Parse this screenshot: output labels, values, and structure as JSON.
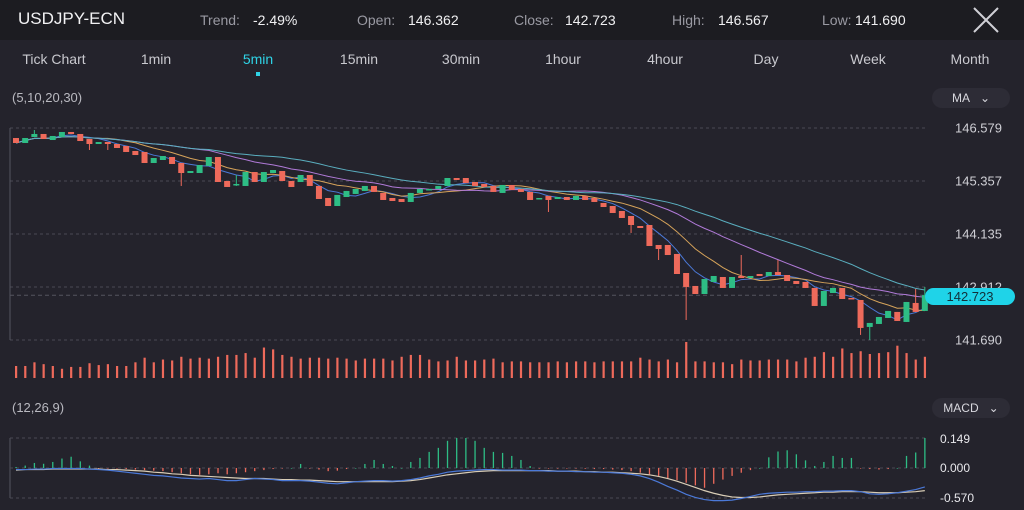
{
  "header": {
    "symbol": "USDJPY-ECN",
    "trend_label": "Trend:",
    "trend": "-2.49%",
    "open_label": "Open:",
    "open": "146.362",
    "close_label": "Close:",
    "close": "142.723",
    "high_label": "High:",
    "high": "146.567",
    "low_label": "Low:",
    "low": "141.690",
    "close_icon": "close-x-icon"
  },
  "tabs": [
    {
      "label": "Tick Chart"
    },
    {
      "label": "1min"
    },
    {
      "label": "5min",
      "active": true
    },
    {
      "label": "15min"
    },
    {
      "label": "30min"
    },
    {
      "label": "1hour"
    },
    {
      "label": "4hour"
    },
    {
      "label": "Day"
    },
    {
      "label": "Week"
    },
    {
      "label": "Month"
    }
  ],
  "indicators": {
    "ma_params": "(5,10,20,30)",
    "ma_select": "MA",
    "macd_params": "(12,26,9)",
    "macd_select": "MACD",
    "chevron_icon": "chevron-down-icon"
  },
  "colors": {
    "up": "#2ebd85",
    "down": "#ee6a5b",
    "accent": "#1fd3e8",
    "ma5": "#4b79d8",
    "ma10": "#d6a35a",
    "ma20": "#b07ad8",
    "ma30": "#5aaebf",
    "macd": "#4b79d8",
    "signal": "#d9cdb6"
  },
  "chart_data": [
    {
      "type": "candlestick",
      "y_ticks": [
        "146.579",
        "145.357",
        "144.135",
        "142.912",
        "141.690"
      ],
      "ylim": [
        141.69,
        146.579
      ],
      "current_price": "142.723",
      "grid": true,
      "ma_periods": [
        5,
        10,
        20,
        30
      ],
      "ohlc": [
        [
          146.348,
          146.348,
          146.233,
          146.233
        ],
        [
          146.233,
          146.348,
          146.233,
          146.348
        ],
        [
          146.371,
          146.533,
          146.371,
          146.441
        ],
        [
          146.441,
          146.441,
          146.325,
          146.325
        ],
        [
          146.302,
          146.395,
          146.302,
          146.395
        ],
        [
          146.371,
          146.487,
          146.371,
          146.487
        ],
        [
          146.487,
          146.487,
          146.441,
          146.441
        ],
        [
          146.441,
          146.441,
          146.279,
          146.279
        ],
        [
          146.325,
          146.325,
          146.072,
          146.21
        ],
        [
          146.21,
          146.256,
          146.21,
          146.256
        ],
        [
          146.256,
          146.256,
          146.072,
          146.21
        ],
        [
          146.21,
          146.21,
          146.118,
          146.118
        ],
        [
          146.164,
          146.164,
          146.026,
          146.026
        ],
        [
          146.049,
          146.049,
          145.956,
          145.956
        ],
        [
          146.026,
          146.026,
          145.772,
          145.772
        ],
        [
          145.772,
          145.887,
          145.772,
          145.887
        ],
        [
          145.841,
          145.933,
          145.841,
          145.933
        ],
        [
          145.91,
          145.91,
          145.749,
          145.749
        ],
        [
          145.772,
          145.772,
          145.242,
          145.541
        ],
        [
          145.541,
          145.587,
          145.541,
          145.587
        ],
        [
          145.541,
          145.726,
          145.541,
          145.726
        ],
        [
          145.703,
          145.91,
          145.703,
          145.91
        ],
        [
          145.91,
          145.91,
          145.334,
          145.334
        ],
        [
          145.357,
          145.357,
          145.219,
          145.219
        ],
        [
          145.265,
          145.495,
          145.242,
          145.288
        ],
        [
          145.242,
          145.564,
          145.242,
          145.564
        ],
        [
          145.564,
          145.564,
          145.334,
          145.334
        ],
        [
          145.334,
          145.564,
          145.334,
          145.564
        ],
        [
          145.541,
          145.61,
          145.541,
          145.61
        ],
        [
          145.587,
          145.587,
          145.357,
          145.357
        ],
        [
          145.357,
          145.357,
          145.219,
          145.219
        ],
        [
          145.334,
          145.495,
          145.334,
          145.495
        ],
        [
          145.495,
          145.495,
          145.242,
          145.242
        ],
        [
          145.242,
          145.242,
          144.942,
          144.942
        ],
        [
          144.965,
          144.965,
          144.78,
          144.78
        ],
        [
          144.78,
          145.035,
          144.78,
          145.035
        ],
        [
          144.988,
          145.127,
          144.988,
          145.127
        ],
        [
          145.058,
          145.173,
          145.058,
          145.173
        ],
        [
          145.127,
          145.242,
          145.127,
          145.242
        ],
        [
          145.242,
          145.242,
          145.104,
          145.104
        ],
        [
          145.081,
          145.081,
          144.919,
          144.919
        ],
        [
          144.965,
          144.965,
          144.896,
          144.896
        ],
        [
          144.942,
          144.942,
          144.873,
          144.873
        ],
        [
          144.873,
          145.081,
          144.873,
          145.081
        ],
        [
          145.081,
          145.173,
          145.081,
          145.173
        ],
        [
          145.15,
          145.173,
          145.15,
          145.173
        ],
        [
          145.173,
          145.242,
          145.173,
          145.242
        ],
        [
          145.242,
          145.426,
          145.242,
          145.426
        ],
        [
          145.426,
          145.426,
          145.38,
          145.38
        ],
        [
          145.426,
          145.426,
          145.311,
          145.311
        ],
        [
          145.334,
          145.334,
          145.242,
          145.242
        ],
        [
          145.288,
          145.288,
          145.219,
          145.219
        ],
        [
          145.242,
          145.242,
          145.104,
          145.104
        ],
        [
          145.081,
          145.265,
          145.081,
          145.265
        ],
        [
          145.265,
          145.265,
          145.15,
          145.15
        ],
        [
          145.173,
          145.173,
          145.104,
          145.104
        ],
        [
          145.104,
          145.104,
          144.919,
          144.919
        ],
        [
          144.942,
          144.965,
          144.942,
          144.965
        ],
        [
          145.012,
          145.012,
          144.642,
          144.919
        ],
        [
          144.942,
          144.988,
          144.942,
          144.988
        ],
        [
          144.988,
          144.988,
          144.919,
          144.919
        ],
        [
          144.919,
          145.012,
          144.919,
          145.012
        ],
        [
          145.012,
          145.012,
          144.919,
          144.919
        ],
        [
          144.965,
          144.965,
          144.873,
          144.873
        ],
        [
          144.85,
          144.85,
          144.757,
          144.757
        ],
        [
          144.78,
          144.78,
          144.619,
          144.619
        ],
        [
          144.665,
          144.665,
          144.504,
          144.504
        ],
        [
          144.55,
          144.55,
          144.158,
          144.342
        ],
        [
          144.319,
          144.319,
          144.273,
          144.273
        ],
        [
          144.342,
          144.342,
          143.858,
          143.858
        ],
        [
          143.881,
          143.881,
          143.535,
          143.789
        ],
        [
          143.881,
          143.881,
          143.65,
          143.65
        ],
        [
          143.674,
          143.674,
          143.212,
          143.212
        ],
        [
          143.235,
          143.235,
          142.152,
          142.913
        ],
        [
          142.936,
          142.936,
          142.751,
          142.751
        ],
        [
          142.751,
          143.097,
          142.751,
          143.097
        ],
        [
          143.028,
          143.166,
          143.028,
          143.166
        ],
        [
          143.143,
          143.143,
          142.89,
          142.89
        ],
        [
          142.89,
          143.143,
          142.89,
          143.143
        ],
        [
          143.166,
          143.65,
          143.12,
          143.12
        ],
        [
          143.12,
          143.166,
          143.12,
          143.166
        ],
        [
          143.212,
          143.212,
          143.166,
          143.166
        ],
        [
          143.166,
          143.258,
          143.166,
          143.258
        ],
        [
          143.258,
          143.535,
          143.189,
          143.189
        ],
        [
          143.189,
          143.189,
          143.051,
          143.051
        ],
        [
          143.051,
          143.051,
          142.982,
          142.982
        ],
        [
          143.028,
          143.028,
          142.89,
          142.89
        ],
        [
          142.89,
          142.89,
          142.475,
          142.475
        ],
        [
          142.475,
          142.82,
          142.475,
          142.82
        ],
        [
          142.774,
          142.89,
          142.774,
          142.89
        ],
        [
          142.89,
          142.89,
          142.636,
          142.636
        ],
        [
          142.659,
          142.659,
          142.636,
          142.636
        ],
        [
          142.613,
          142.613,
          141.807,
          141.968
        ],
        [
          141.991,
          142.083,
          141.69,
          142.083
        ],
        [
          142.06,
          142.221,
          142.06,
          142.221
        ],
        [
          142.198,
          142.36,
          142.198,
          142.36
        ],
        [
          142.337,
          142.337,
          142.129,
          142.129
        ],
        [
          142.106,
          142.567,
          142.106,
          142.567
        ],
        [
          142.544,
          142.867,
          142.337,
          142.337
        ],
        [
          142.36,
          142.913,
          142.36,
          142.723
        ]
      ],
      "volume": [
        13,
        13,
        17,
        15,
        13,
        10,
        12,
        12,
        16,
        14,
        15,
        13,
        13,
        17,
        22,
        17,
        20,
        19,
        23,
        21,
        22,
        21,
        23,
        25,
        25,
        27,
        22,
        33,
        31,
        25,
        23,
        21,
        22,
        22,
        21,
        22,
        21,
        19,
        21,
        21,
        21,
        19,
        23,
        25,
        25,
        20,
        18,
        19,
        23,
        19,
        19,
        20,
        21,
        17,
        18,
        18,
        17,
        17,
        17,
        18,
        17,
        18,
        18,
        17,
        18,
        18,
        18,
        18,
        22,
        20,
        18,
        20,
        17,
        39,
        18,
        18,
        17,
        17,
        15,
        20,
        19,
        19,
        20,
        20,
        20,
        18,
        22,
        23,
        28,
        23,
        32,
        27,
        29,
        26,
        27,
        28,
        35,
        27,
        20,
        23
      ]
    },
    {
      "type": "macd",
      "params": "(12,26,9)",
      "y_ticks": [
        "0.149",
        "0.000",
        "-0.570"
      ],
      "histogram": [
        0.005,
        0.012,
        0.025,
        0.021,
        0.03,
        0.047,
        0.056,
        0.033,
        0.012,
        -0.005,
        -0.005,
        -0.01,
        -0.02,
        -0.03,
        -0.04,
        -0.05,
        -0.06,
        -0.08,
        -0.1,
        -0.12,
        -0.13,
        -0.12,
        -0.1,
        -0.12,
        -0.1,
        -0.08,
        -0.06,
        -0.04,
        -0.02,
        -0.005,
        0.0,
        0.02,
        -0.01,
        -0.03,
        -0.06,
        -0.05,
        -0.02,
        0.0,
        0.02,
        0.04,
        0.02,
        0.01,
        0.0,
        0.03,
        0.05,
        0.08,
        0.1,
        0.135,
        0.149,
        0.149,
        0.135,
        0.1,
        0.08,
        0.075,
        0.06,
        0.04,
        0.01,
        -0.005,
        -0.005,
        -0.01,
        -0.01,
        -0.01,
        -0.015,
        -0.02,
        -0.02,
        -0.03,
        -0.04,
        -0.06,
        -0.09,
        -0.12,
        -0.15,
        -0.19,
        -0.23,
        -0.28,
        -0.33,
        -0.376,
        -0.3,
        -0.22,
        -0.15,
        -0.09,
        -0.04,
        0.0,
        0.053,
        0.082,
        0.088,
        0.068,
        0.038,
        0.01,
        0.03,
        0.06,
        0.05,
        0.05,
        -0.005,
        -0.02,
        -0.03,
        -0.02,
        0.0,
        0.06,
        0.077,
        0.149
      ],
      "macd": [
        -0.03,
        -0.03,
        -0.02,
        -0.02,
        -0.01,
        -0.01,
        -0.01,
        -0.01,
        -0.02,
        -0.03,
        -0.04,
        -0.06,
        -0.08,
        -0.1,
        -0.12,
        -0.14,
        -0.15,
        -0.17,
        -0.19,
        -0.2,
        -0.21,
        -0.2,
        -0.22,
        -0.24,
        -0.24,
        -0.22,
        -0.2,
        -0.21,
        -0.22,
        -0.24,
        -0.24,
        -0.24,
        -0.25,
        -0.27,
        -0.29,
        -0.3,
        -0.28,
        -0.26,
        -0.25,
        -0.24,
        -0.24,
        -0.25,
        -0.24,
        -0.22,
        -0.19,
        -0.15,
        -0.12,
        -0.08,
        -0.06,
        -0.05,
        -0.04,
        -0.03,
        -0.03,
        -0.04,
        -0.04,
        -0.04,
        -0.05,
        -0.05,
        -0.06,
        -0.06,
        -0.06,
        -0.07,
        -0.07,
        -0.08,
        -0.08,
        -0.09,
        -0.1,
        -0.12,
        -0.15,
        -0.2,
        -0.27,
        -0.35,
        -0.42,
        -0.5,
        -0.56,
        -0.6,
        -0.62,
        -0.62,
        -0.61,
        -0.58,
        -0.54,
        -0.5,
        -0.48,
        -0.47,
        -0.46,
        -0.46,
        -0.45,
        -0.45,
        -0.44,
        -0.44,
        -0.43,
        -0.43,
        -0.45,
        -0.49,
        -0.5,
        -0.49,
        -0.47,
        -0.44,
        -0.41,
        -0.36
      ],
      "signal": [
        -0.04,
        -0.03,
        -0.03,
        -0.03,
        -0.02,
        -0.02,
        -0.02,
        -0.02,
        -0.02,
        -0.02,
        -0.03,
        -0.03,
        -0.04,
        -0.05,
        -0.06,
        -0.08,
        -0.09,
        -0.11,
        -0.12,
        -0.14,
        -0.15,
        -0.16,
        -0.17,
        -0.18,
        -0.19,
        -0.2,
        -0.2,
        -0.2,
        -0.21,
        -0.22,
        -0.22,
        -0.23,
        -0.23,
        -0.24,
        -0.25,
        -0.26,
        -0.26,
        -0.26,
        -0.26,
        -0.26,
        -0.26,
        -0.26,
        -0.25,
        -0.24,
        -0.22,
        -0.19,
        -0.16,
        -0.13,
        -0.11,
        -0.09,
        -0.07,
        -0.06,
        -0.05,
        -0.05,
        -0.05,
        -0.05,
        -0.05,
        -0.05,
        -0.05,
        -0.06,
        -0.06,
        -0.06,
        -0.07,
        -0.07,
        -0.08,
        -0.08,
        -0.09,
        -0.1,
        -0.11,
        -0.13,
        -0.16,
        -0.2,
        -0.25,
        -0.31,
        -0.37,
        -0.43,
        -0.48,
        -0.52,
        -0.55,
        -0.56,
        -0.56,
        -0.55,
        -0.53,
        -0.51,
        -0.5,
        -0.49,
        -0.48,
        -0.47,
        -0.46,
        -0.46,
        -0.45,
        -0.45,
        -0.45,
        -0.46,
        -0.47,
        -0.47,
        -0.47,
        -0.46,
        -0.45,
        -0.43
      ]
    }
  ]
}
